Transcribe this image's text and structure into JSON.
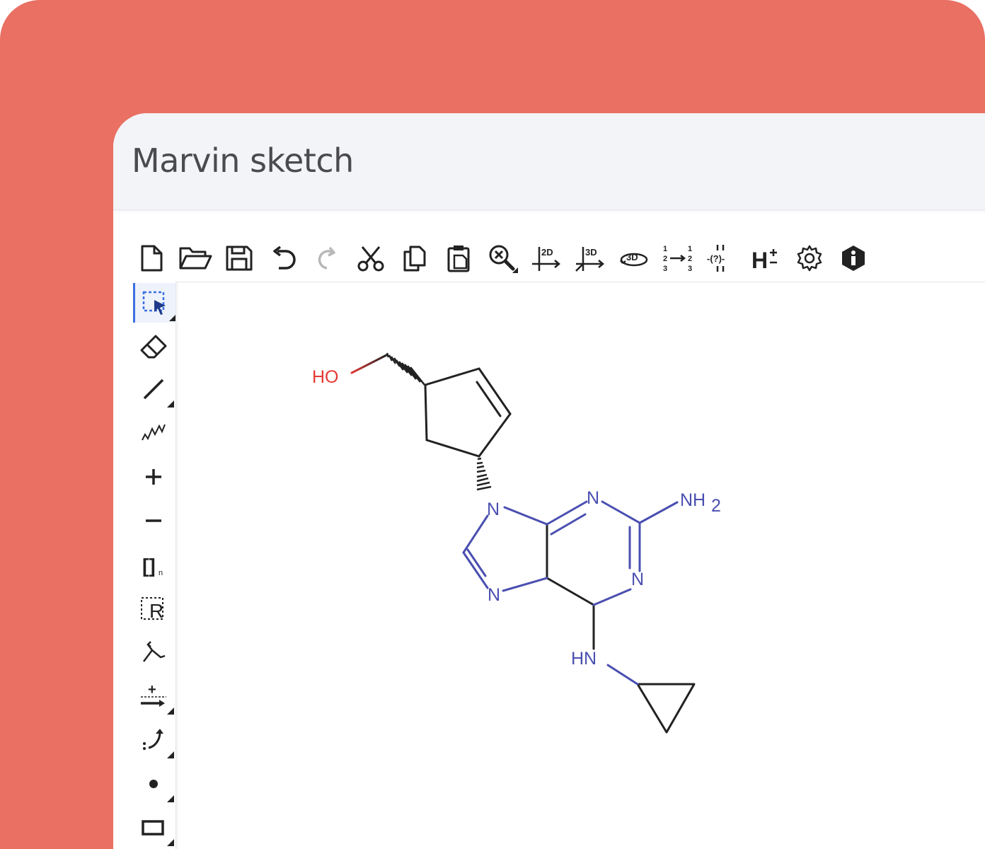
{
  "app": {
    "title": "Marvin sketch"
  },
  "colors": {
    "background": "#e97062",
    "nitrogen": "#4a4fb0",
    "oxygen": "#e53935",
    "bond": "#222222",
    "accent": "#3a6fe0"
  },
  "toolbar": {
    "items": [
      {
        "icon": "new-document-icon"
      },
      {
        "icon": "open-folder-icon"
      },
      {
        "icon": "save-icon"
      },
      {
        "icon": "undo-icon"
      },
      {
        "icon": "redo-icon"
      },
      {
        "icon": "cut-icon"
      },
      {
        "icon": "copy-icon"
      },
      {
        "icon": "paste-icon"
      },
      {
        "icon": "zoom-icon"
      },
      {
        "icon": "clean-2d-icon",
        "label": "2D"
      },
      {
        "icon": "clean-3d-icon",
        "label": "3D"
      },
      {
        "icon": "rotate-3d-icon",
        "label": "3D"
      },
      {
        "icon": "renumber-icon",
        "a": "1",
        "b": "2",
        "c": "3"
      },
      {
        "icon": "query-bond-icon",
        "label": "-(?)-"
      },
      {
        "icon": "hydrogen-icon",
        "label": "H"
      },
      {
        "icon": "settings-icon"
      },
      {
        "icon": "info-icon"
      }
    ]
  },
  "lefttools": {
    "items": [
      {
        "icon": "select-icon"
      },
      {
        "icon": "eraser-icon"
      },
      {
        "icon": "single-bond-icon"
      },
      {
        "icon": "chain-icon"
      },
      {
        "icon": "plus-charge-icon",
        "label": "+"
      },
      {
        "icon": "minus-charge-icon",
        "label": "−"
      },
      {
        "icon": "sgroup-bracket-icon",
        "label": "[]",
        "sub": "n"
      },
      {
        "icon": "rgroup-icon",
        "label": "R"
      },
      {
        "icon": "attachment-icon"
      },
      {
        "icon": "reaction-arrow-icon",
        "label": "+"
      },
      {
        "icon": "electron-flow-icon"
      },
      {
        "icon": "radical-icon"
      },
      {
        "icon": "rectangle-shape-icon"
      }
    ]
  },
  "molecule": {
    "labels": {
      "ho": "HO",
      "n9": "N",
      "n3": "N",
      "nh2": "NH",
      "nh2_sub": "2",
      "n1": "N",
      "n7": "N",
      "hn": "HN"
    }
  }
}
